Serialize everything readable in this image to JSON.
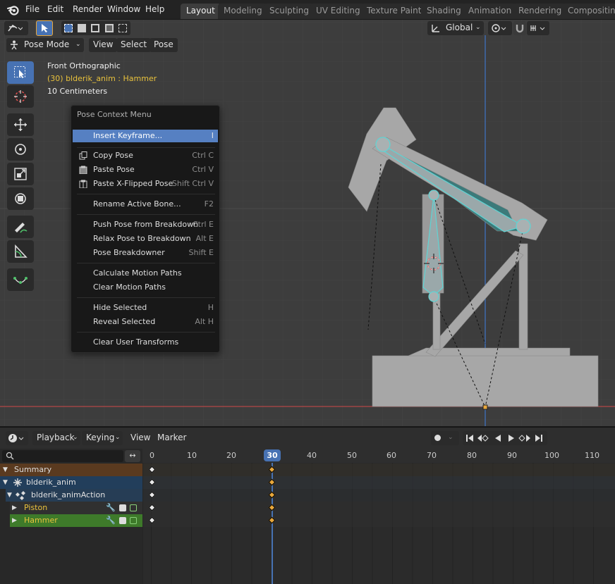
{
  "topbar": {
    "menus": [
      "File",
      "Edit",
      "Render",
      "Window",
      "Help"
    ],
    "workspaces": [
      "Layout",
      "Modeling",
      "Sculpting",
      "UV Editing",
      "Texture Paint",
      "Shading",
      "Animation",
      "Rendering",
      "Compositing"
    ],
    "active_workspace": "Layout"
  },
  "viewport_header": {
    "mode": "Pose Mode",
    "menus": [
      "View",
      "Select",
      "Pose"
    ],
    "orientation": "Global"
  },
  "overlay": {
    "view_name": "Front Orthographic",
    "object_info": "(30) blderik_anim : Hammer",
    "scale": "10 Centimeters"
  },
  "context_menu": {
    "title": "Pose Context Menu",
    "items": [
      {
        "label": "Insert Keyframe...",
        "shortcut": "I",
        "highlighted": true
      },
      {
        "label": "Copy Pose",
        "shortcut": "Ctrl C",
        "icon": "copy-icon"
      },
      {
        "label": "Paste Pose",
        "shortcut": "Ctrl V",
        "icon": "paste-icon"
      },
      {
        "label": "Paste X-Flipped Pose",
        "shortcut": "Shift Ctrl V",
        "icon": "paste-flipped-icon"
      },
      {
        "label": "Rename Active Bone...",
        "shortcut": "F2"
      },
      {
        "label": "Push Pose from Breakdown",
        "shortcut": "Ctrl E"
      },
      {
        "label": "Relax Pose to Breakdown",
        "shortcut": "Alt E"
      },
      {
        "label": "Pose Breakdowner",
        "shortcut": "Shift E"
      },
      {
        "label": "Calculate Motion Paths",
        "shortcut": ""
      },
      {
        "label": "Clear Motion Paths",
        "shortcut": ""
      },
      {
        "label": "Hide Selected",
        "shortcut": "H"
      },
      {
        "label": "Reveal Selected",
        "shortcut": "Alt H"
      },
      {
        "label": "Clear User Transforms",
        "shortcut": ""
      }
    ]
  },
  "timeline": {
    "menus": [
      "Playback",
      "Keying",
      "View",
      "Marker"
    ],
    "current_frame": "30",
    "ruler": [
      "0",
      "10",
      "20",
      "30",
      "40",
      "50",
      "60",
      "70",
      "80",
      "90",
      "100",
      "110"
    ],
    "channels": [
      {
        "label": "Summary"
      },
      {
        "label": "blderik_anim"
      },
      {
        "label": "blderik_animAction"
      },
      {
        "label": "Piston"
      },
      {
        "label": "Hammer"
      }
    ]
  },
  "colors": {
    "accent": "#4772b3",
    "menu_highlight": "#5680c2",
    "bone_selected": "#5fd4d4",
    "mesh_gray": "#a7a7a7",
    "keyframe_selected": "#e9a83c",
    "channel_summary": "#5a3a1f",
    "channel_object": "#223e5b",
    "channel_bone_piston": "#3a3a3a",
    "channel_bone_hammer": "#3e7a2a"
  }
}
